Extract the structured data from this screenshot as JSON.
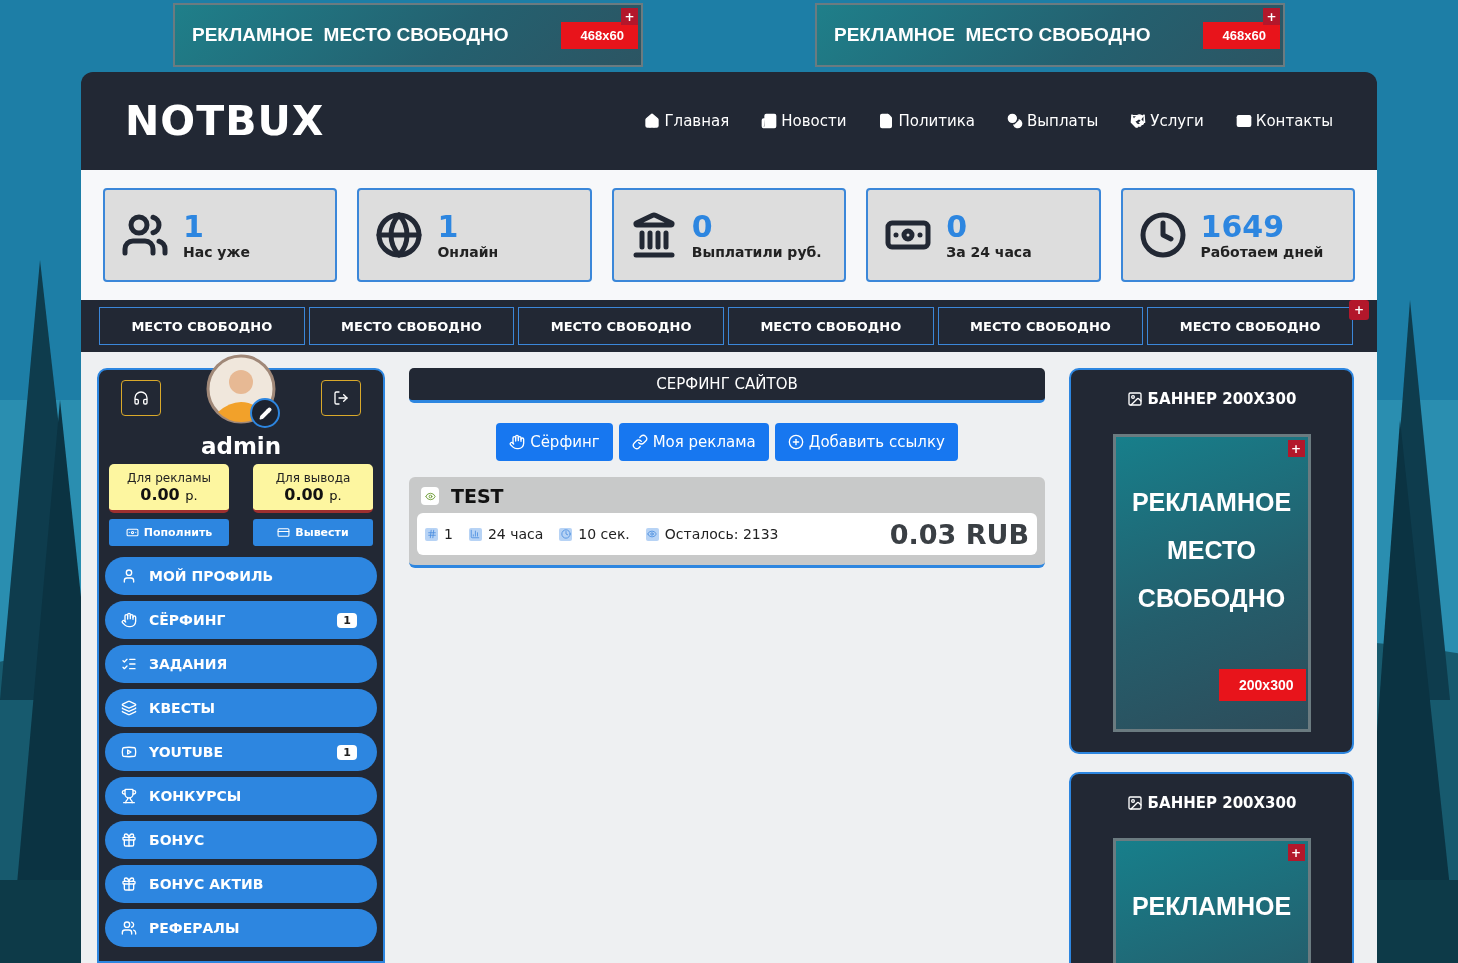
{
  "top_banners": [
    {
      "text": "РЕКЛАМНОЕ  МЕСТО СВОБОДНО",
      "size": "468x60",
      "corner": "+"
    },
    {
      "text": "РЕКЛАМНОЕ  МЕСТО СВОБОДНО",
      "size": "468x60",
      "corner": "+"
    }
  ],
  "header": {
    "logo": "NOTBUX",
    "nav": [
      {
        "label": "Главная"
      },
      {
        "label": "Новости"
      },
      {
        "label": "Политика"
      },
      {
        "label": "Выплаты"
      },
      {
        "label": "Услуги"
      },
      {
        "label": "Контакты"
      }
    ]
  },
  "stats": [
    {
      "value": "1",
      "label": "Нас уже"
    },
    {
      "value": "1",
      "label": "Онлайн"
    },
    {
      "value": "0",
      "label": "Выплатили руб."
    },
    {
      "value": "0",
      "label": "За 24 часа"
    },
    {
      "value": "1649",
      "label": "Работаем дней"
    }
  ],
  "ad_strip": {
    "items": [
      "МЕСТО СВОБОДНО",
      "МЕСТО СВОБОДНО",
      "МЕСТО СВОБОДНО",
      "МЕСТО СВОБОДНО",
      "МЕСТО СВОБОДНО",
      "МЕСТО СВОБОДНО"
    ],
    "corner": "+"
  },
  "profile": {
    "username": "admin",
    "balances": [
      {
        "label": "Для рекламы",
        "amount": "0.00",
        "unit": "р.",
        "action": "Пополнить"
      },
      {
        "label": "Для вывода",
        "amount": "0.00",
        "unit": "р.",
        "action": "Вывести"
      }
    ],
    "menu": [
      {
        "label": "МОЙ ПРОФИЛЬ"
      },
      {
        "label": "СЁРФИНГ",
        "badge": "1"
      },
      {
        "label": "ЗАДАНИЯ"
      },
      {
        "label": "КВЕСТЫ"
      },
      {
        "label": "YOUTUBE",
        "badge": "1"
      },
      {
        "label": "КОНКУРСЫ"
      },
      {
        "label": "БОНУС"
      },
      {
        "label": "БОНУС АКТИВ"
      },
      {
        "label": "РЕФЕРАЛЫ"
      }
    ]
  },
  "surfing": {
    "title": "СЕРФИНГ САЙТОВ",
    "buttons": [
      "Сёрфинг",
      "Моя реклама",
      "Добавить ссылку"
    ],
    "tasks": [
      {
        "title": "TEST",
        "number": "1",
        "period": "24 часа",
        "duration": "10 сек.",
        "remaining": "Осталось: 2133",
        "price": "0.03 RUB"
      }
    ]
  },
  "side_banners": [
    {
      "title": "БАННЕР 200X300",
      "lines": [
        "РЕКЛАМНОЕ",
        "МЕСТО",
        "СВОБОДНО"
      ],
      "size": "200x300",
      "corner": "+"
    },
    {
      "title": "БАННЕР 200X300",
      "lines": [
        "РЕКЛАМНОЕ"
      ],
      "corner": "+"
    }
  ]
}
